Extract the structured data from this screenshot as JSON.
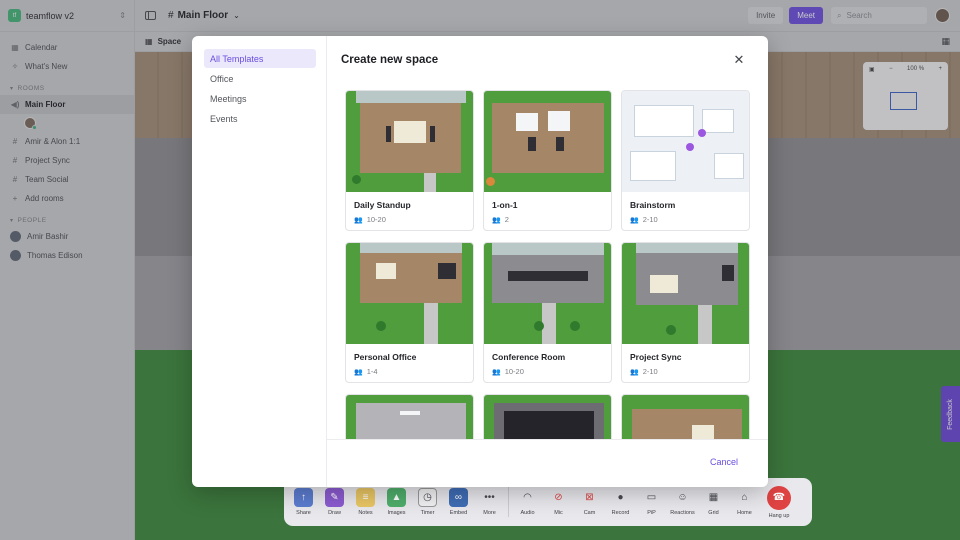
{
  "app": {
    "name": "teamflow v2"
  },
  "sidebar": {
    "top_items": [
      {
        "label": "Calendar",
        "icon": "calendar-icon"
      },
      {
        "label": "What's New",
        "icon": "sparkle-icon"
      }
    ],
    "rooms_label": "ROOMS",
    "rooms": [
      {
        "label": "Main Floor",
        "icon": "speaker-icon",
        "active": true
      },
      {
        "label": "Amir & Alon 1:1",
        "icon": "hash-icon"
      },
      {
        "label": "Project Sync",
        "icon": "hash-icon"
      },
      {
        "label": "Team Social",
        "icon": "hash-icon"
      },
      {
        "label": "Add rooms",
        "icon": "plus-icon"
      }
    ],
    "people_label": "PEOPLE",
    "people": [
      {
        "label": "Amir Bashir"
      },
      {
        "label": "Thomas Edison"
      }
    ]
  },
  "topbar": {
    "floor_title": "Main Floor",
    "invite_label": "Invite",
    "meet_label": "Meet",
    "search_placeholder": "Search"
  },
  "subbar": {
    "space_label": "Space"
  },
  "minimap": {
    "zoom": "100 %"
  },
  "feedback_label": "Feedback",
  "dock": {
    "items": [
      {
        "label": "Share",
        "icon": "share-icon"
      },
      {
        "label": "Draw",
        "icon": "draw-icon"
      },
      {
        "label": "Notes",
        "icon": "notes-icon"
      },
      {
        "label": "Images",
        "icon": "image-icon"
      },
      {
        "label": "Timer",
        "icon": "timer-icon"
      },
      {
        "label": "Embed",
        "icon": "link-icon"
      },
      {
        "label": "More",
        "icon": "more-icon"
      },
      {
        "label": "Audio",
        "icon": "headphones-icon"
      },
      {
        "label": "Mic",
        "icon": "mic-off-icon"
      },
      {
        "label": "Cam",
        "icon": "camera-off-icon"
      },
      {
        "label": "Record",
        "icon": "record-icon"
      },
      {
        "label": "PiP",
        "icon": "pip-icon"
      },
      {
        "label": "Reactions",
        "icon": "emoji-icon"
      },
      {
        "label": "Grid",
        "icon": "grid-icon"
      },
      {
        "label": "Home",
        "icon": "home-icon"
      },
      {
        "label": "Hang up",
        "icon": "hangup-icon"
      }
    ]
  },
  "modal": {
    "title": "Create new space",
    "nav": [
      {
        "label": "All Templates",
        "active": true
      },
      {
        "label": "Office"
      },
      {
        "label": "Meetings"
      },
      {
        "label": "Events"
      }
    ],
    "templates": [
      {
        "name": "Daily Standup",
        "capacity": "10-20"
      },
      {
        "name": "1-on-1",
        "capacity": "2"
      },
      {
        "name": "Brainstorm",
        "capacity": "2-10"
      },
      {
        "name": "Personal Office",
        "capacity": "1-4"
      },
      {
        "name": "Conference Room",
        "capacity": "10-20"
      },
      {
        "name": "Project Sync",
        "capacity": "2-10"
      },
      {
        "name": "",
        "capacity": ""
      },
      {
        "name": "",
        "capacity": ""
      },
      {
        "name": "",
        "capacity": ""
      }
    ],
    "cancel_label": "Cancel"
  },
  "colors": {
    "accent": "#6a4ee0",
    "hangup": "#e04343",
    "feedback": "#6b47d8"
  }
}
